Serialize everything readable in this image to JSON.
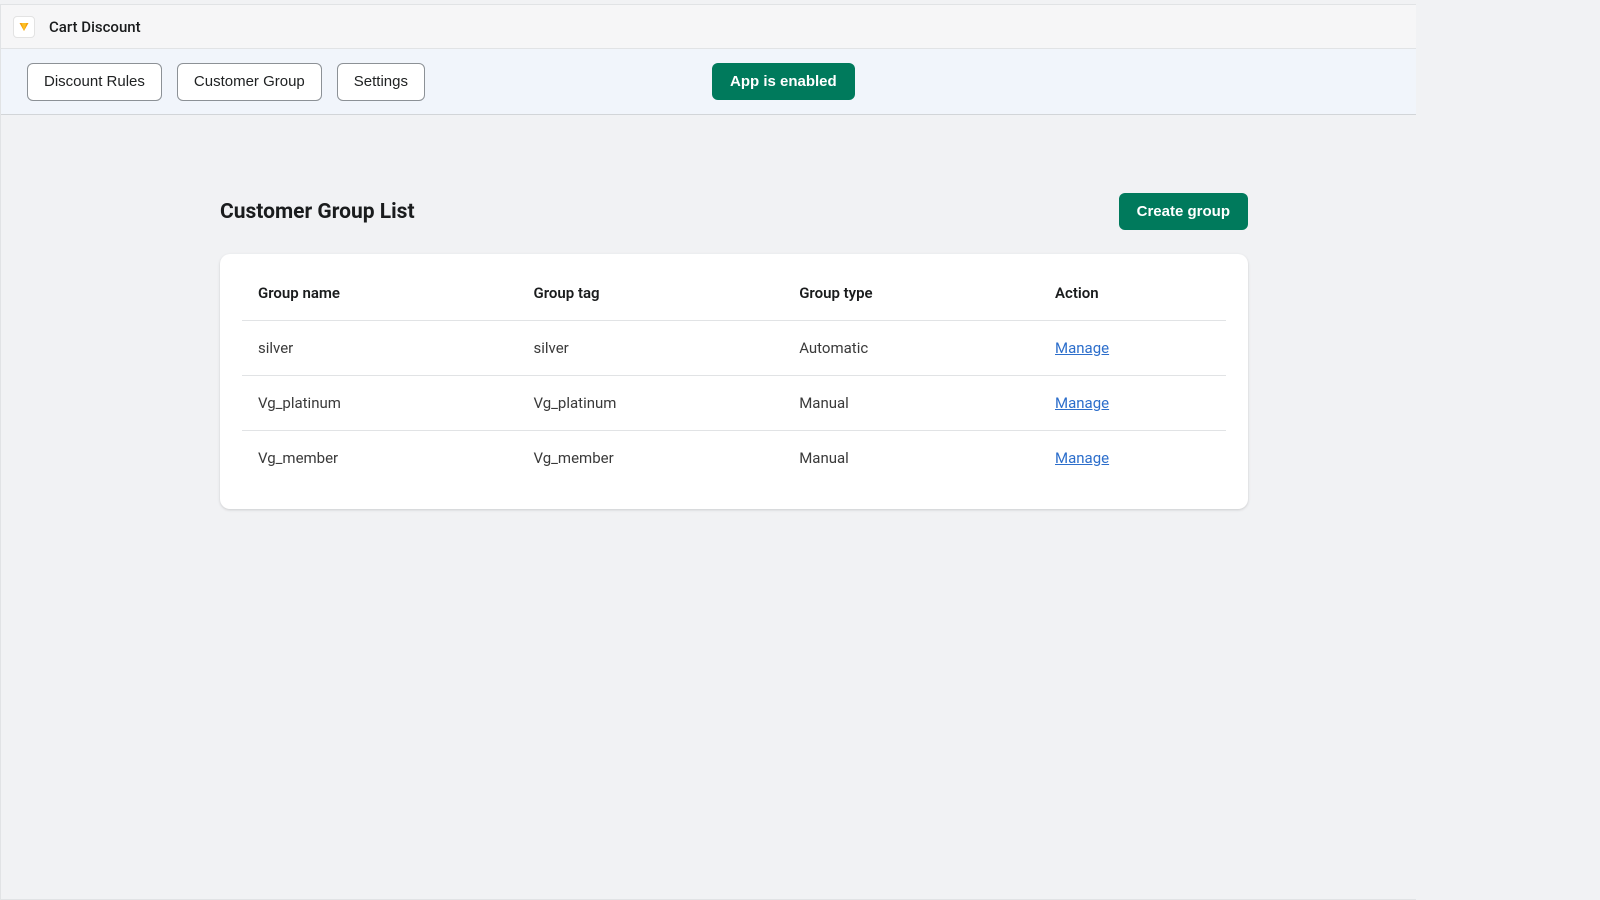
{
  "header": {
    "app_title": "Cart Discount"
  },
  "toolbar": {
    "tabs": [
      {
        "label": "Discount Rules"
      },
      {
        "label": "Customer Group"
      },
      {
        "label": "Settings"
      }
    ],
    "status_label": "App is enabled"
  },
  "page": {
    "title": "Customer Group List",
    "create_button": "Create group"
  },
  "table": {
    "headers": {
      "name": "Group name",
      "tag": "Group tag",
      "type": "Group type",
      "action": "Action"
    },
    "action_label": "Manage",
    "rows": [
      {
        "name": "silver",
        "tag": "silver",
        "type": "Automatic"
      },
      {
        "name": "Vg_platinum",
        "tag": "Vg_platinum",
        "type": "Manual"
      },
      {
        "name": "Vg_member",
        "tag": "Vg_member",
        "type": "Manual"
      }
    ]
  },
  "colors": {
    "primary_green": "#007A5C",
    "link_blue": "#2c6ecb",
    "border_gray": "#e1e3e5",
    "bg_gray": "#f1f2f4"
  }
}
